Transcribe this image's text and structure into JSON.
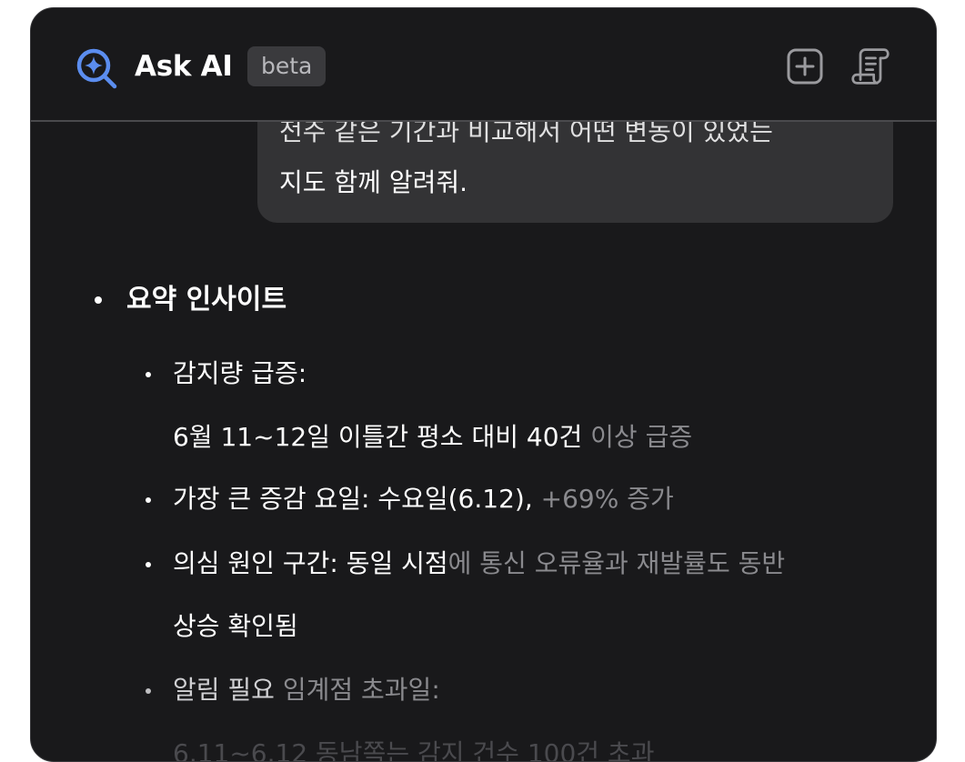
{
  "header": {
    "title": "Ask AI",
    "badge": "beta",
    "logo_icon": "ai-search-sparkle-icon",
    "new_chat_icon": "plus-square-icon",
    "history_icon": "scroll-document-icon",
    "accent_color": "#5b8def"
  },
  "user_message": {
    "line1": "전주 같은 기간과 비교해서 어떤 변동이 있었는",
    "line2": "지도 함께 알려줘."
  },
  "answer": {
    "heading": "요약 인사이트",
    "items": [
      {
        "label": "감지량 급증:",
        "detail_main": "6월 11~12일 이틀간 평소 대비 40건",
        "detail_dim": " 이상 급증"
      },
      {
        "label": "가장 큰 증감 요일: 수요일(6.12),",
        "label_dim": " +69% 증가"
      },
      {
        "label": "의심 원인 구간: 동일 시점",
        "label_dim": "에 통신 오류율과 재발률도 동반",
        "cont": "상승 확인됨"
      },
      {
        "label": "알림 필요",
        "label_dim": " 임계점 초과일:",
        "detail_fade": "6.11~6.12 동남쪽는 감지 건수 100건 초과"
      }
    ]
  }
}
